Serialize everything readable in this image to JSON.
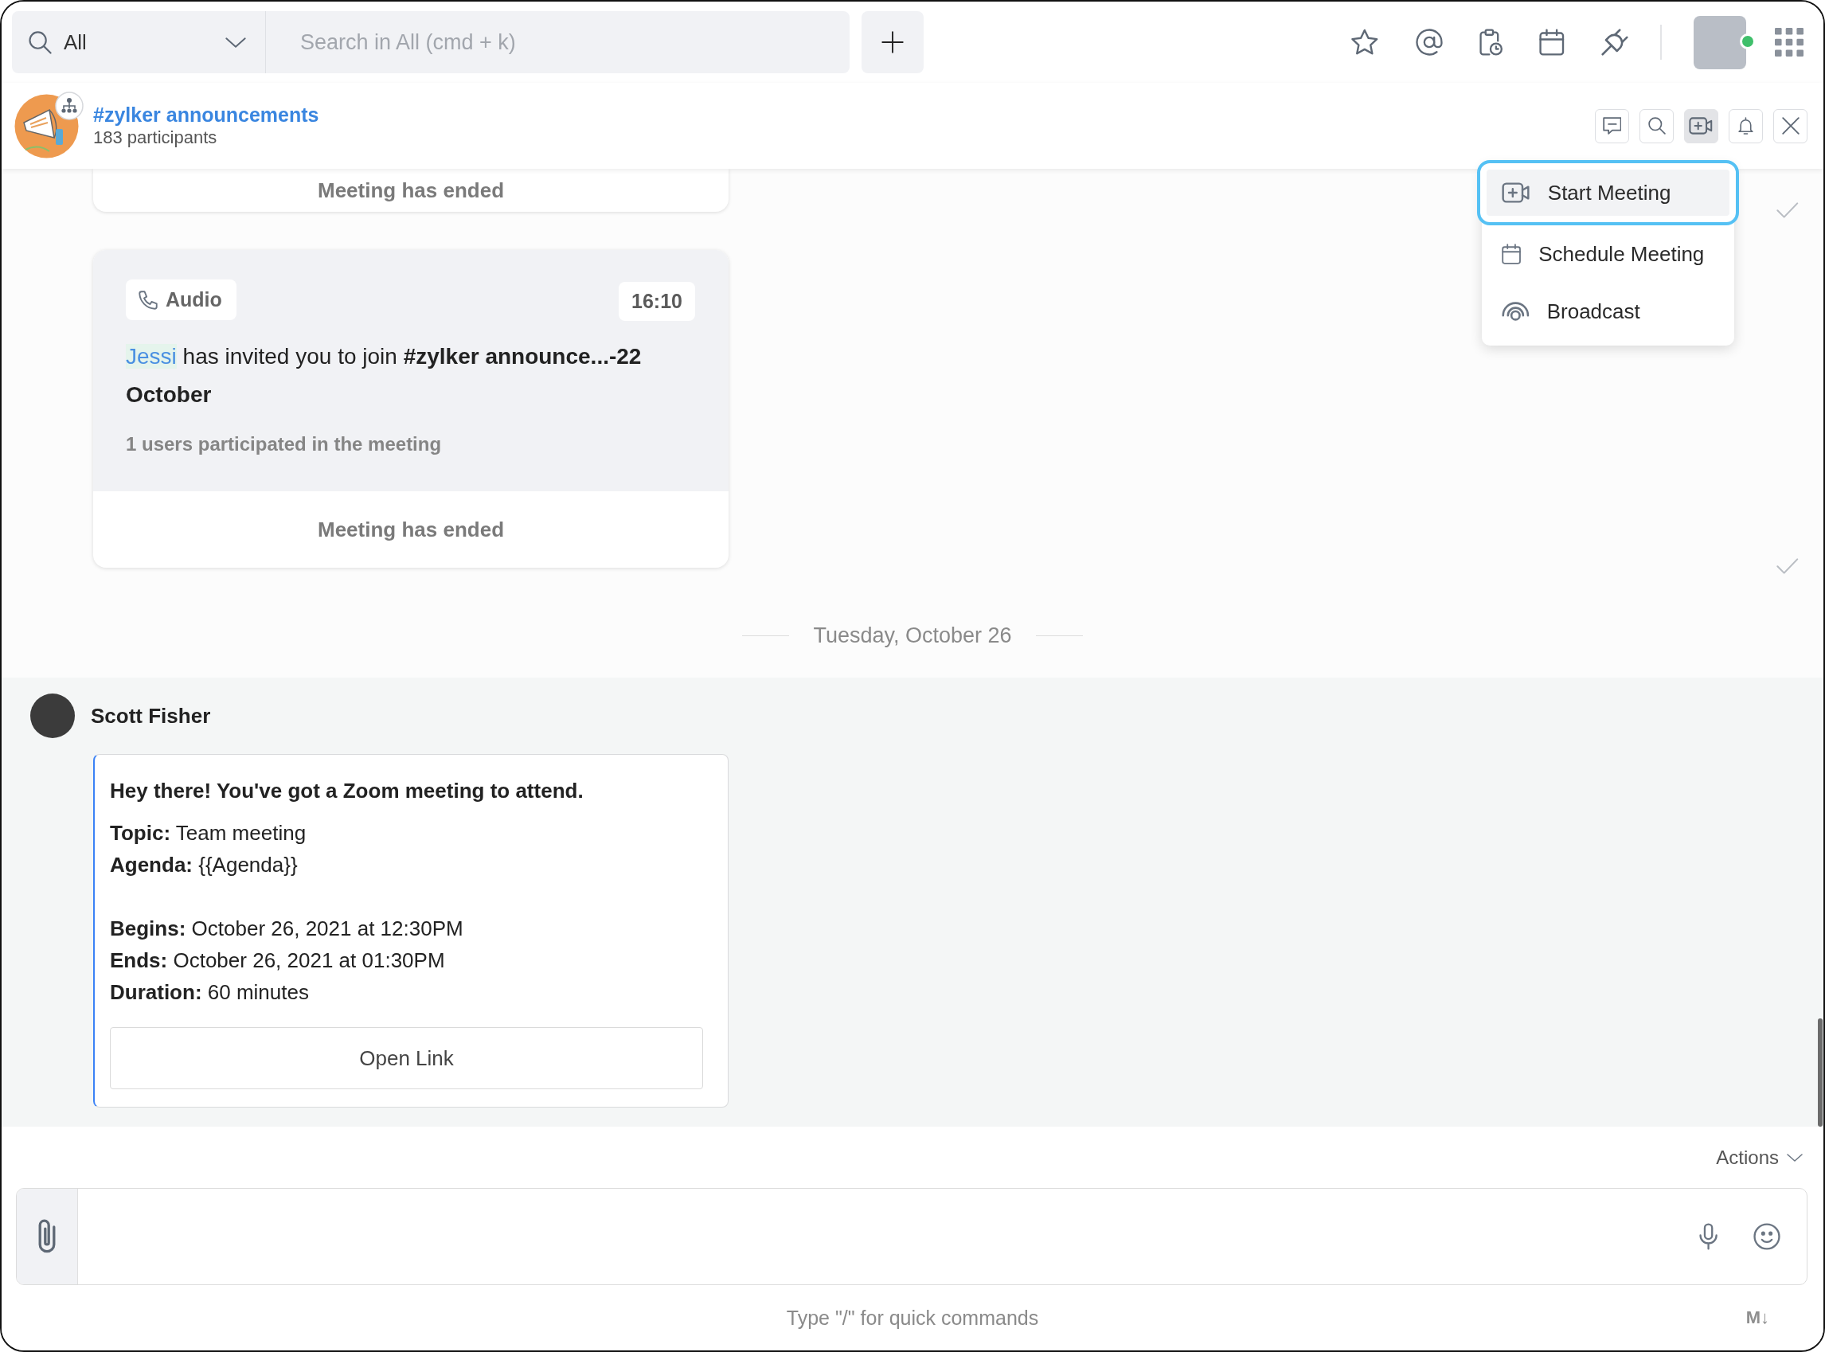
{
  "top_bar": {
    "search_scope": "All",
    "search_placeholder": "Search in All (cmd + k)",
    "user": {
      "online": true
    }
  },
  "channel": {
    "name": "#zylker announcements",
    "participants": "183 participants"
  },
  "header_buttons": [
    {
      "kind": "threads",
      "selected": false
    },
    {
      "kind": "search",
      "selected": false
    },
    {
      "kind": "meeting",
      "selected": true
    },
    {
      "kind": "notifications",
      "selected": false
    },
    {
      "kind": "close",
      "selected": false
    }
  ],
  "meeting_menu": {
    "items": [
      {
        "kind": "start",
        "label": "Start Meeting",
        "selected": true
      },
      {
        "kind": "schedule",
        "label": "Schedule Meeting",
        "selected": false
      },
      {
        "kind": "broadcast",
        "label": "Broadcast",
        "selected": false
      }
    ]
  },
  "messages": [
    {
      "kind": "call_tail",
      "status": "Meeting has ended",
      "read": true
    },
    {
      "kind": "call_card",
      "call_type": "Audio",
      "time": "16:10",
      "inviter": "Jessi",
      "invite_text": "has invited you to join **#zylker announce...-22 October**",
      "participation": "1 users participated in the meeting",
      "status": "Meeting has ended",
      "read": true
    },
    {
      "kind": "date_divider",
      "label": "Tuesday, October 26"
    },
    {
      "kind": "message",
      "sender": "Scott Fisher",
      "highlighted": true,
      "card": {
        "title": "Hey there! You've got a Zoom meeting to attend.",
        "groups": [
          [
            "**Topic:** Team meeting",
            "**Agenda:** {{Agenda}}"
          ],
          [
            "**Begins:** October 26, 2021 at 12:30PM",
            "**Ends:** October 26, 2021 at 01:30PM",
            "**Duration:** 60 minutes"
          ]
        ],
        "button": "Open Link"
      }
    }
  ],
  "composer": {
    "actions": "Actions",
    "hint": "Type \"/\" for quick commands",
    "markdown": "M↓"
  }
}
